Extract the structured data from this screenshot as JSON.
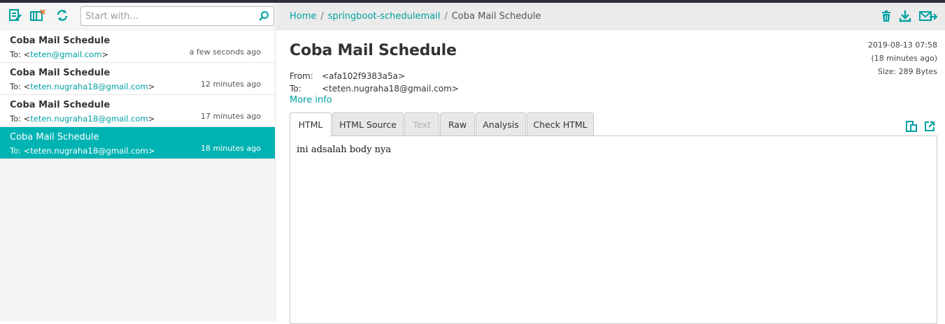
{
  "toolbar": {
    "search_placeholder": "Start with..."
  },
  "messages": [
    {
      "subject": "Coba Mail Schedule",
      "to_prefix": "To: <",
      "to_addr": "teten@gmail.com",
      "to_suffix": ">",
      "time": "a few seconds ago"
    },
    {
      "subject": "Coba Mail Schedule",
      "to_prefix": "To: <",
      "to_addr": "teten.nugraha18@gmail.com",
      "to_suffix": ">",
      "time": "12 minutes ago"
    },
    {
      "subject": "Coba Mail Schedule",
      "to_prefix": "To: <",
      "to_addr": "teten.nugraha18@gmail.com",
      "to_suffix": ">",
      "time": "17 minutes ago"
    },
    {
      "subject": "Coba Mail Schedule",
      "to_prefix": "To: <",
      "to_addr": "teten.nugraha18@gmail.com",
      "to_suffix": ">",
      "time": "18 minutes ago"
    }
  ],
  "breadcrumb": {
    "home": "Home",
    "sep": "/",
    "mailbox": "springboot-schedulemail",
    "current": "Coba Mail Schedule"
  },
  "message": {
    "title": "Coba Mail Schedule",
    "date": "2019-08-13 07:58",
    "relative": "(18 minutes ago)",
    "size": "Size: 289 Bytes",
    "from_label": "From:",
    "from_value": "<afa102f9383a5a>",
    "to_label": "To:",
    "to_value": "<teten.nugraha18@gmail.com>",
    "more_info": "More info",
    "body": "ini adsalah body nya"
  },
  "tabs": [
    "HTML",
    "HTML Source",
    "Text",
    "Raw",
    "Analysis",
    "Check HTML"
  ],
  "colors": {
    "accent": "#00a0a0",
    "selected_row": "#00b3b3",
    "top_strip": "#2a2f36"
  }
}
